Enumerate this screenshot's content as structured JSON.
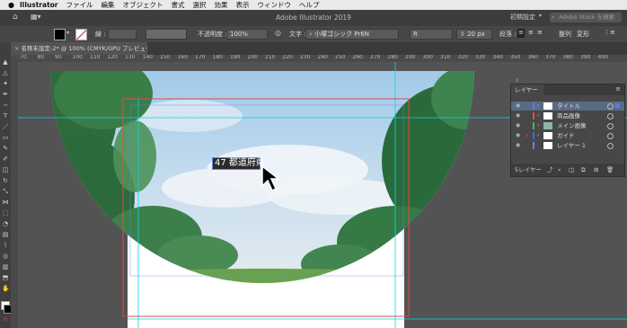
{
  "menubar": {
    "apple": "",
    "app_name": "Illustrator",
    "items": [
      "ファイル",
      "編集",
      "オブジェクト",
      "書式",
      "選択",
      "効果",
      "表示",
      "ウィンドウ",
      "ヘルプ"
    ]
  },
  "titlebar": {
    "title": "Adobe Illustrator 2019",
    "workspace": "初期設定",
    "search_placeholder": "Adobe Stock を検索"
  },
  "control_bar": {
    "stroke_label": "線 :",
    "opacity_label": "不透明度 :",
    "opacity_value": "100%",
    "char_label": "文字 :",
    "font_name": "小塚ゴシック Pr6N",
    "font_style": "R",
    "font_size": "20 px",
    "paragraph_label": "段落 :",
    "align_label": "整列",
    "transform_label": "変形"
  },
  "document_tab": {
    "label": "名称未設定-2* @ 100% (CMYK/GPU プレビュー)"
  },
  "ruler": {
    "marks": [
      "70",
      "80",
      "90",
      "100",
      "110",
      "120",
      "130",
      "140",
      "150",
      "160",
      "170",
      "180",
      "190",
      "200",
      "210",
      "220",
      "230",
      "240",
      "250",
      "260",
      "270",
      "280",
      "290",
      "300",
      "310",
      "320",
      "330",
      "340",
      "350",
      "360",
      "370",
      "380",
      "390",
      "400"
    ]
  },
  "canvas": {
    "selected_text": "47 都道府県"
  },
  "layers_panel": {
    "tab_label": "レイヤー",
    "layers": [
      {
        "name": "タイトル",
        "color": "#4f7bff",
        "selected": true,
        "locked": false
      },
      {
        "name": "商品画像",
        "color": "#e34a4a",
        "selected": false,
        "locked": false
      },
      {
        "name": "メイン画像",
        "color": "#40c040",
        "selected": false,
        "locked": false
      },
      {
        "name": "ガイド",
        "color": "#2f6fe0",
        "selected": false,
        "locked": true
      },
      {
        "name": "レイヤー 1",
        "color": "#7a7aff",
        "selected": false,
        "locked": false
      }
    ],
    "count_label": "5レイヤー"
  },
  "colors": {
    "ui_bg": "#535353",
    "panel_bg": "#474747",
    "selection_outline": "#e04a4a",
    "guide": "#00d9e8"
  }
}
